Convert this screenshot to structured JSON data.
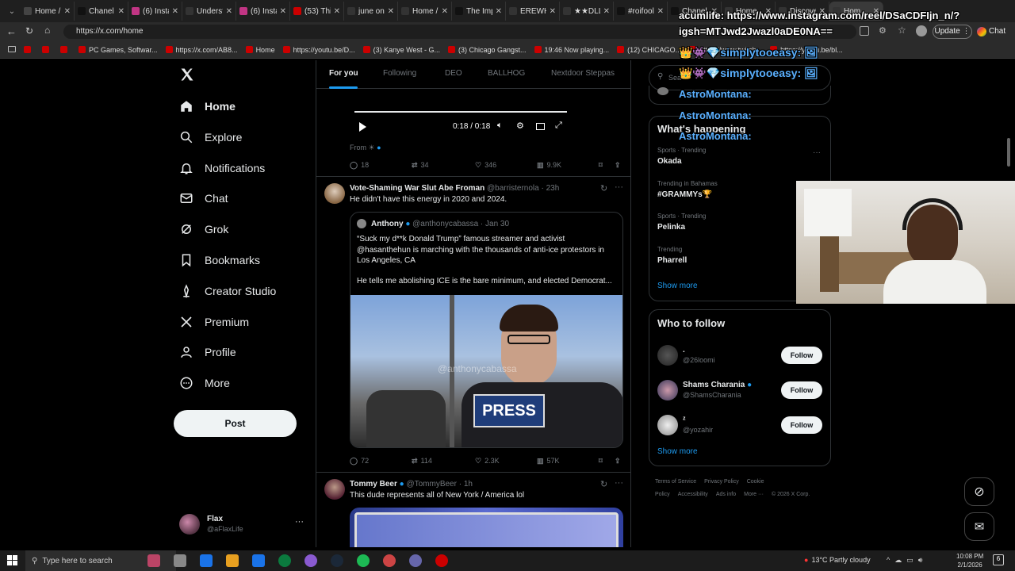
{
  "browser": {
    "tabs": [
      {
        "label": "Home /",
        "color": "#444"
      },
      {
        "label": "Chanel U",
        "color": "#111"
      },
      {
        "label": "(6) Insta",
        "color": "#c13584"
      },
      {
        "label": "Understa",
        "color": "#333"
      },
      {
        "label": "(6) Insta",
        "color": "#c13584"
      },
      {
        "label": "(53) This",
        "color": "#c00"
      },
      {
        "label": "june on X",
        "color": "#333"
      },
      {
        "label": "Home / X",
        "color": "#333"
      },
      {
        "label": "The Imp",
        "color": "#111"
      },
      {
        "label": "EREWHO",
        "color": "#333"
      },
      {
        "label": "★★DLL",
        "color": "#333"
      },
      {
        "label": "#roifool",
        "color": "#111"
      },
      {
        "label": "Chanel",
        "color": "#111"
      },
      {
        "label": "Home",
        "color": "#333"
      },
      {
        "label": "Discove",
        "color": "#333"
      },
      {
        "label": "Hom",
        "color": "#333"
      }
    ],
    "url": "https://x.com/home",
    "update_label": "Update",
    "chat_label": "Chat",
    "bookmarks": [
      {
        "label": ""
      },
      {
        "label": ""
      },
      {
        "label": ""
      },
      {
        "label": "PC Games, Softwar..."
      },
      {
        "label": "https://x.com/AB8..."
      },
      {
        "label": "Home"
      },
      {
        "label": "https://youtu.be/D..."
      },
      {
        "label": "(3) Kanye West - G..."
      },
      {
        "label": "(3) Chicago Gangst..."
      },
      {
        "label": "19:46 Now playing..."
      },
      {
        "label": "(12) CHICAGO..."
      },
      {
        "label": "https://www.twitch..."
      },
      {
        "label": "https://youtu.be/bl..."
      }
    ]
  },
  "nav": {
    "items": [
      {
        "label": "Home",
        "icon": "home-icon"
      },
      {
        "label": "Explore",
        "icon": "search-icon"
      },
      {
        "label": "Notifications",
        "icon": "bell-icon"
      },
      {
        "label": "Chat",
        "icon": "mail-icon"
      },
      {
        "label": "Grok",
        "icon": "grok-icon"
      },
      {
        "label": "Bookmarks",
        "icon": "bookmark-icon"
      },
      {
        "label": "Creator Studio",
        "icon": "creator-icon"
      },
      {
        "label": "Premium",
        "icon": "x-icon"
      },
      {
        "label": "Profile",
        "icon": "person-icon"
      },
      {
        "label": "More",
        "icon": "more-circle-icon"
      }
    ],
    "post_label": "Post",
    "user": {
      "name": "Flax",
      "handle": "@aFlaxLife"
    }
  },
  "feed": {
    "tabs": [
      "For you",
      "Following",
      "DEO",
      "BALLHOG",
      "Nextdoor Steppas"
    ],
    "video": {
      "time": "0:18 / 0:18",
      "from": "From"
    },
    "post0": {
      "replies": "18",
      "reposts": "34",
      "likes": "346",
      "views": "9.9K"
    },
    "post1": {
      "name": "Vote-Shaming War Slut Abe Froman",
      "handle": "@barristernola",
      "time": "· 23h",
      "text": "He didn't have this energy in 2020 and 2024.",
      "quote": {
        "name": "Anthony",
        "handle": "@anthonycabassa",
        "time": "· Jan 30",
        "text1": "“Suck my d**k Donald Trump” famous streamer and activist @hasanthehun is marching with the thousands of anti-ice protestors in Los Angeles, CA",
        "text2": "He tells me abolishing ICE is the bare minimum, and elected Democrat...",
        "watermark": "@anthonycabassa",
        "press": "PRESS"
      },
      "replies": "72",
      "reposts": "114",
      "likes": "2.3K",
      "views": "57K"
    },
    "post2": {
      "name": "Tommy Beer",
      "handle": "@TommyBeer",
      "time": "· 1h",
      "text": "This dude represents all of New York / America lol"
    }
  },
  "right": {
    "search_placeholder": "Sea",
    "happening_title": "What's happening",
    "trends": [
      {
        "context": "Sports · Trending",
        "title": "Okada"
      },
      {
        "context": "Trending in Bahamas",
        "title": "#GRAMMYs🏆"
      },
      {
        "context": "Sports · Trending",
        "title": "Pelinka"
      },
      {
        "context": "Trending",
        "title": "Pharrell"
      }
    ],
    "show_more": "Show more",
    "wtf_title": "Who to follow",
    "follow": [
      {
        "name": ".",
        "handle": "@26loomi",
        "verified": false
      },
      {
        "name": "Shams Charania",
        "handle": "@ShamsCharania",
        "verified": true
      },
      {
        "name": "",
        "handle": "@yozahir",
        "verified": false
      }
    ],
    "follow_label": "Follow",
    "follow_name3": "ᶻ",
    "footer": [
      "Terms of Service",
      "Privacy Policy",
      "Cookie Policy",
      "Accessibility",
      "Ads info",
      "More ···",
      "© 2026 X Corp."
    ]
  },
  "overlay": {
    "line1": "acumlife: https://www.instagram.com/reel/DSaCDFIjn_n/?",
    "line2": "igsh=MTJwd2Jwazl0aDE0NA==",
    "user1": "simplytooeasy:",
    "user2": "simplytooeasy:",
    "astro": "AstroMontana:"
  },
  "taskbar": {
    "search_placeholder": "Type here to search",
    "weather": "13°C  Partly cloudy",
    "time": "10:08 PM",
    "date": "2/1/2026"
  },
  "colors": {
    "accent": "#1d9bf0",
    "bg": "#000000",
    "border": "#2f3336"
  }
}
